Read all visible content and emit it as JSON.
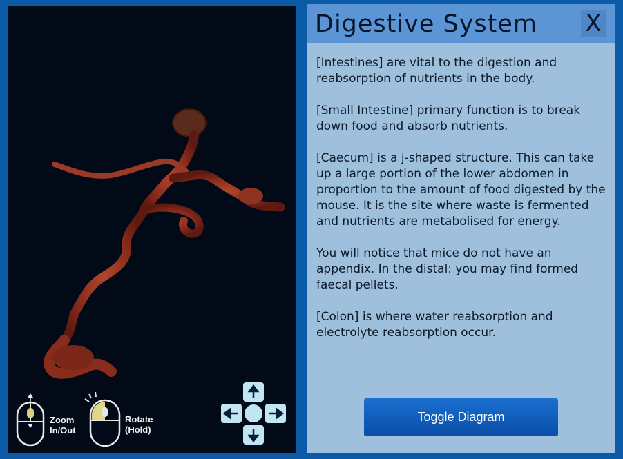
{
  "viewer": {
    "controls": {
      "zoom_label_line1": "Zoom",
      "zoom_label_line2": "In/Out",
      "rotate_label_line1": "Rotate",
      "rotate_label_line2": "(Hold)",
      "zoom_icon": "mouse-scroll-icon",
      "rotate_icon": "mouse-left-click-icon",
      "dpad_icon": "arrow-keys-dpad-icon"
    }
  },
  "panel": {
    "title": "Digestive System",
    "close_label": "X",
    "paragraphs": [
      "[Intestines] are vital to the digestion and reabsorption of nutrients in the body.",
      "[Small Intestine] primary function is to break down food and absorb nutrients.",
      "[Caecum] is a j-shaped structure. This can take up a large portion of the lower abdomen in proportion to the amount of food digested by the mouse. It is the site where waste is fermented and nutrients are metabolised for energy.",
      "You will notice that mice do not have an appendix. In the distal: you may find formed faecal pellets.",
      "[Colon] is where water reabsorption and electrolyte reabsorption occur."
    ],
    "toggle_button_label": "Toggle Diagram"
  },
  "colors": {
    "frame": "#0a5aa8",
    "viewer_bg": "#020917",
    "panel_bg": "#9fc0dd",
    "header_bg": "#5b95d6",
    "button_bg": "#0a5cbf",
    "organ": "#8a2c1c"
  }
}
